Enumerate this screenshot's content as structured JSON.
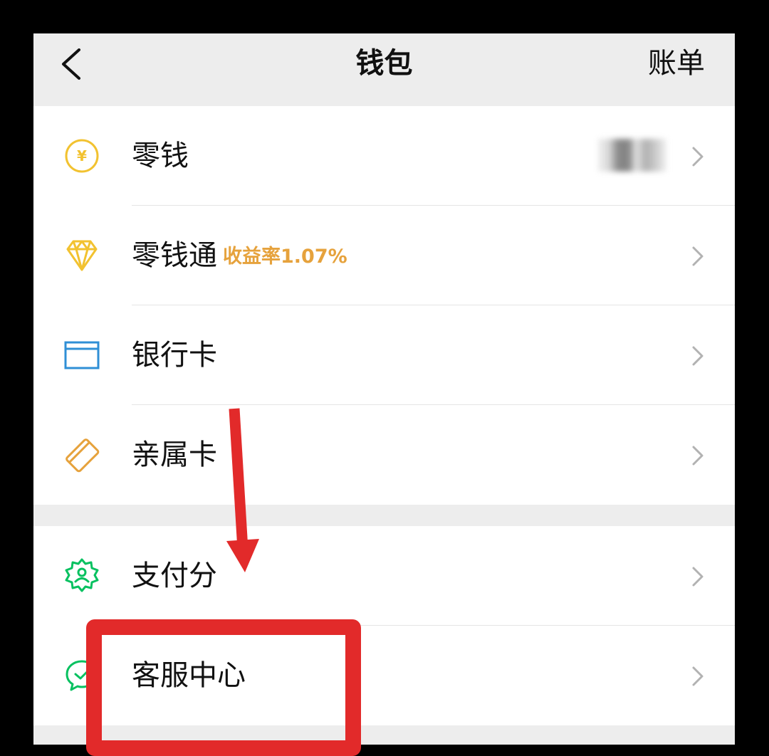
{
  "header": {
    "title": "钱包",
    "bill_label": "账单"
  },
  "group1": {
    "items": [
      {
        "label": "零钱",
        "icon": "yuan-coin-icon"
      },
      {
        "label": "零钱通",
        "sub": "收益率1.07%",
        "icon": "diamond-icon"
      },
      {
        "label": "银行卡",
        "icon": "bank-card-icon"
      },
      {
        "label": "亲属卡",
        "icon": "family-card-icon"
      }
    ]
  },
  "group2": {
    "items": [
      {
        "label": "支付分",
        "icon": "pay-score-badge-icon"
      },
      {
        "label": "客服中心",
        "icon": "customer-service-chat-icon"
      }
    ]
  },
  "colors": {
    "gold": "#f2c230",
    "accent_orange": "#e6a23c",
    "bank_blue": "#2f8fd6",
    "green": "#07c160",
    "annotation_red": "#e22a2a"
  }
}
